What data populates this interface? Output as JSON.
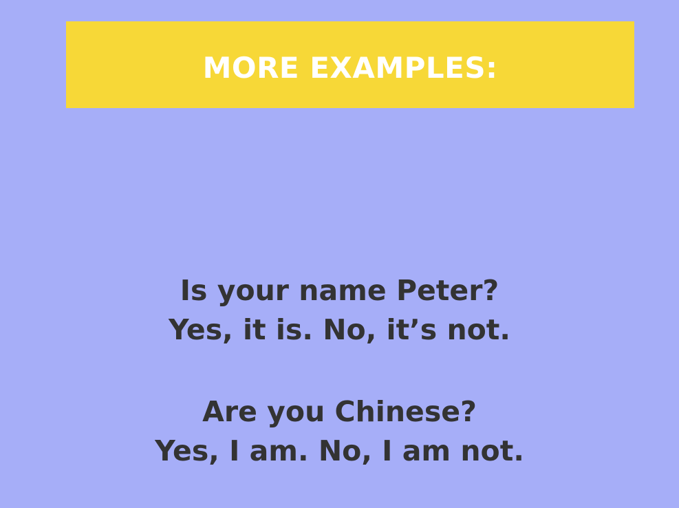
{
  "slide": {
    "heading": "MORE EXAMPLES:",
    "examples": [
      {
        "question": "Is your name Peter?",
        "answer": "Yes, it is. No, it’s not."
      },
      {
        "question": "Are you Chinese?",
        "answer": "Yes, I am. No, I am not."
      }
    ]
  },
  "colors": {
    "background": "#a6aef8",
    "banner": "#f7d837",
    "heading_text": "#ffffff",
    "body_text": "#333333"
  }
}
